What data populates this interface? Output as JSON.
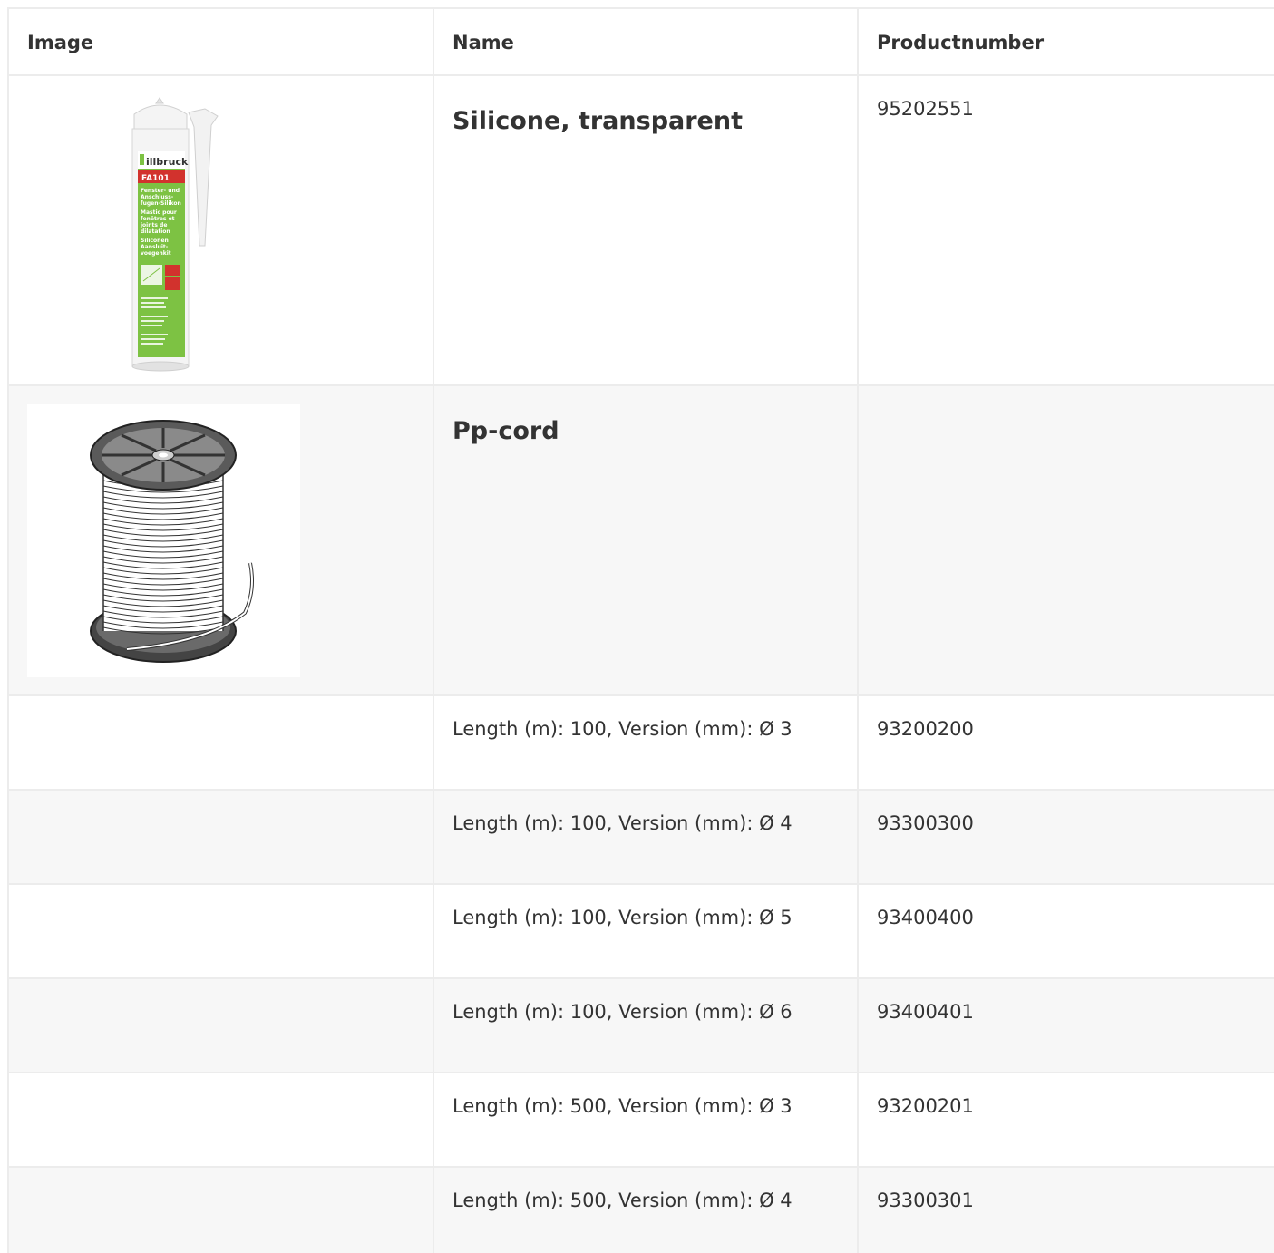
{
  "table": {
    "headers": {
      "image": "Image",
      "name": "Name",
      "productnumber": "Productnumber"
    },
    "products": [
      {
        "name": "Silicone, transparent",
        "productnumber": "95202551",
        "image_icon": "silicone-cartridge",
        "image_text": {
          "brand": "illbruck",
          "code": "FA101",
          "line1": "Fenster- und",
          "line2": "Anschluss-",
          "line3": "fugen-Silikon",
          "line4": "Mastic pour",
          "line5": "fenêtres et",
          "line6": "joints de",
          "line7": "dilatation",
          "line8": "Siliconen",
          "line9": "Aansluit-",
          "line10": "voegenkit"
        }
      },
      {
        "name": "Pp-cord",
        "productnumber": "",
        "image_icon": "cord-spool"
      }
    ],
    "variants": [
      {
        "name": "Length (m): 100, Version (mm): Ø 3",
        "productnumber": "93200200"
      },
      {
        "name": "Length (m): 100, Version (mm): Ø 4",
        "productnumber": "93300300"
      },
      {
        "name": "Length (m): 100, Version (mm): Ø 5",
        "productnumber": "93400400"
      },
      {
        "name": "Length (m): 100, Version (mm): Ø 6",
        "productnumber": "93400401"
      },
      {
        "name": "Length (m): 500, Version (mm): Ø 3",
        "productnumber": "93200201"
      },
      {
        "name": "Length (m): 500, Version (mm): Ø 4",
        "productnumber": "93300301"
      }
    ]
  },
  "colors": {
    "text": "#333333",
    "border": "#ececec",
    "row_shade": "#f7f7f7",
    "cartridge_green": "#7dc243",
    "cartridge_red": "#d2322d"
  }
}
